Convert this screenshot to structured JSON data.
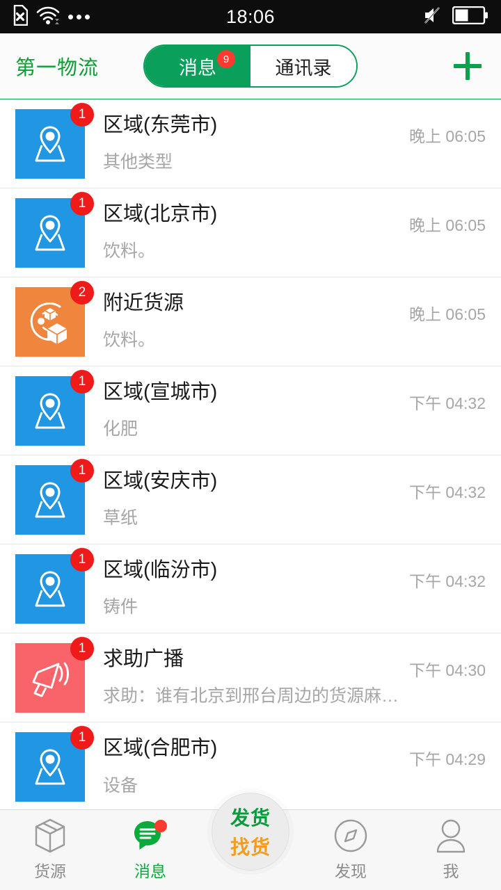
{
  "status_bar": {
    "time": "18:06",
    "left_icons": [
      "no-sim-icon",
      "wifi-icon",
      "more-dots-icon"
    ],
    "right_icons": [
      "mute-icon",
      "battery-icon"
    ],
    "battery_level": 45
  },
  "header": {
    "brand": "第一物流",
    "tabs": [
      {
        "label": "消息",
        "active": true,
        "badge": "9"
      },
      {
        "label": "通讯录",
        "active": false,
        "badge": ""
      }
    ],
    "add_button": "add-icon",
    "accent_green": "#0aa05c",
    "divider_green": "#0aa050"
  },
  "messages": [
    {
      "title": "区域(东莞市)",
      "subtitle": "其他类型",
      "time": "晚上 06:05",
      "badge": "1",
      "icon": "map-pin-icon",
      "icon_bg": "#2196e3"
    },
    {
      "title": "区域(北京市)",
      "subtitle": "饮料。",
      "time": "晚上 06:05",
      "badge": "1",
      "icon": "map-pin-icon",
      "icon_bg": "#2196e3"
    },
    {
      "title": "附近货源",
      "subtitle": "饮料。",
      "time": "晚上 06:05",
      "badge": "2",
      "icon": "nearby-cargo-icon",
      "icon_bg": "#f0853e"
    },
    {
      "title": "区域(宣城市)",
      "subtitle": "化肥",
      "time": "下午 04:32",
      "badge": "1",
      "icon": "map-pin-icon",
      "icon_bg": "#2196e3"
    },
    {
      "title": "区域(安庆市)",
      "subtitle": "草纸",
      "time": "下午 04:32",
      "badge": "1",
      "icon": "map-pin-icon",
      "icon_bg": "#2196e3"
    },
    {
      "title": "区域(临汾市)",
      "subtitle": "铸件",
      "time": "下午 04:32",
      "badge": "1",
      "icon": "map-pin-icon",
      "icon_bg": "#2196e3"
    },
    {
      "title": "求助广播",
      "subtitle": "求助：谁有北京到邢台周边的货源麻烦…",
      "time": "下午 04:30",
      "badge": "1",
      "icon": "megaphone-icon",
      "icon_bg": "#f9636a"
    },
    {
      "title": "区域(合肥市)",
      "subtitle": "设备",
      "time": "下午 04:29",
      "badge": "1",
      "icon": "map-pin-icon",
      "icon_bg": "#2196e3"
    }
  ],
  "tabbar": {
    "items": [
      {
        "label": "货源",
        "icon": "box-icon",
        "active": false
      },
      {
        "label": "消息",
        "icon": "message-bubble-icon",
        "active": true,
        "dot": true
      },
      {
        "label": "发现",
        "icon": "compass-icon",
        "active": false
      },
      {
        "label": "我",
        "icon": "person-icon",
        "active": false
      }
    ],
    "fab": {
      "line1": "发货",
      "line2": "找货",
      "line1_color": "#0b9b3c",
      "line2_color": "#f39c1f"
    }
  }
}
